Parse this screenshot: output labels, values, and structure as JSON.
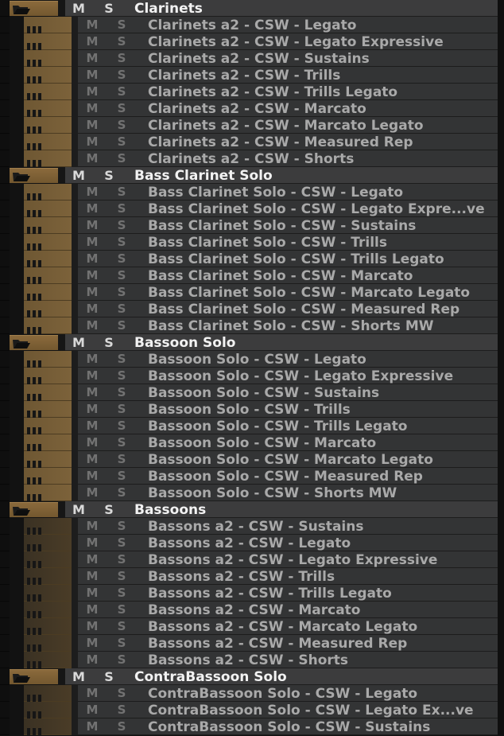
{
  "buttons": {
    "mute": "M",
    "solo": "S"
  },
  "colors": {
    "folder_track": "#7c613a",
    "child_track": "#745b35",
    "child_track_dim": "#433727",
    "folder_panel": "#3c3c3d",
    "child_panel": "#333435"
  },
  "icons": {
    "folder": "open-folder-icon",
    "track": "audio-bars-icon"
  },
  "folders": [
    {
      "name": "Clarinets",
      "tracks": [
        "Clarinets a2 - CSW - Legato",
        "Clarinets a2 - CSW - Legato Expressive",
        "Clarinets a2 - CSW - Sustains",
        "Clarinets a2 - CSW - Trills",
        "Clarinets a2 - CSW - Trills Legato",
        "Clarinets a2 - CSW - Marcato",
        "Clarinets a2 - CSW - Marcato Legato",
        "Clarinets a2 - CSW - Measured Rep",
        "Clarinets a2 - CSW - Shorts"
      ]
    },
    {
      "name": "Bass Clarinet Solo",
      "tracks": [
        "Bass Clarinet Solo - CSW - Legato",
        "Bass Clarinet Solo - CSW - Legato Expre...ve",
        "Bass Clarinet Solo - CSW - Sustains",
        "Bass Clarinet Solo - CSW - Trills",
        "Bass Clarinet Solo - CSW - Trills Legato",
        "Bass Clarinet Solo - CSW - Marcato",
        "Bass Clarinet Solo - CSW - Marcato Legato",
        "Bass Clarinet Solo - CSW - Measured Rep",
        "Bass Clarinet Solo - CSW - Shorts MW"
      ]
    },
    {
      "name": "Bassoon Solo",
      "tracks": [
        "Bassoon Solo - CSW - Legato",
        "Bassoon Solo - CSW - Legato Expressive",
        "Bassoon Solo - CSW - Sustains",
        "Bassoon Solo - CSW - Trills",
        "Bassoon Solo - CSW - Trills Legato",
        "Bassoon Solo - CSW - Marcato",
        "Bassoon Solo - CSW - Marcato Legato",
        "Bassoon Solo - CSW - Measured Rep",
        "Bassoon Solo - CSW - Shorts MW"
      ]
    },
    {
      "name": "Bassoons",
      "dim": true,
      "tracks": [
        "Bassons a2 - CSW - Sustains",
        "Bassons a2 - CSW - Legato",
        "Bassons a2 - CSW - Legato Expressive",
        "Bassons a2 - CSW - Trills",
        "Bassons a2 - CSW - Trills Legato",
        "Bassons a2 - CSW - Marcato",
        "Bassons a2 - CSW - Marcato Legato",
        "Bassons a2 - CSW - Measured Rep",
        "Bassons a2 - CSW - Shorts"
      ]
    },
    {
      "name": "ContraBassoon Solo",
      "dim": true,
      "tracks": [
        "ContraBassoon Solo - CSW - Legato",
        "ContraBassoon Solo - CSW - Legato Ex...ve",
        "ContraBassoon Solo - CSW - Sustains"
      ]
    }
  ]
}
